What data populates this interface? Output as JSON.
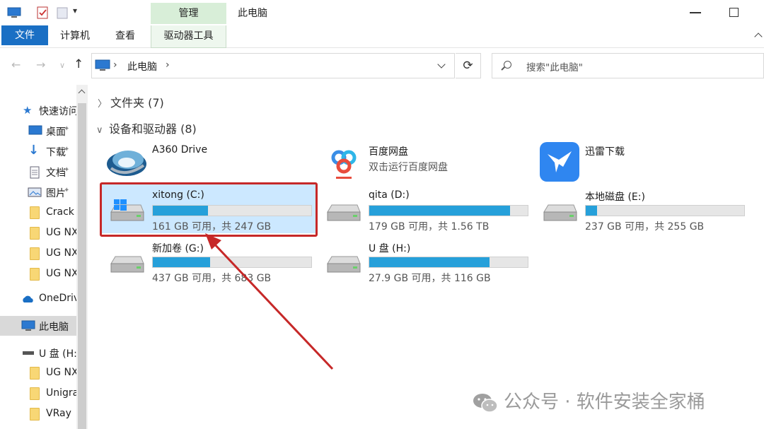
{
  "window": {
    "title": "此电脑",
    "manage_tab": "管理"
  },
  "ribbon": {
    "file": "文件",
    "computer": "计算机",
    "view": "查看",
    "drive_tools": "驱动器工具"
  },
  "address": {
    "crumb": "此电脑",
    "separator": "›"
  },
  "search": {
    "placeholder": "搜索\"此电脑\""
  },
  "nav": {
    "quick_access": "快速访问",
    "items": [
      {
        "label": "桌面",
        "icon": "desktop-icon",
        "pinned": true
      },
      {
        "label": "下载",
        "icon": "download-icon",
        "pinned": true
      },
      {
        "label": "文档",
        "icon": "document-icon",
        "pinned": true
      },
      {
        "label": "图片",
        "icon": "picture-icon",
        "pinned": true
      },
      {
        "label": "Crack",
        "icon": "folder-icon"
      },
      {
        "label": "UG NX",
        "icon": "folder-icon"
      },
      {
        "label": "UG NX",
        "icon": "folder-icon"
      },
      {
        "label": "UG NX",
        "icon": "folder-icon"
      }
    ],
    "onedrive": "OneDrive",
    "this_pc": "此电脑",
    "udisk": "U 盘 (H:)",
    "udisk_items": [
      {
        "label": "UG NX",
        "icon": "folder-icon"
      },
      {
        "label": "Unigraphics",
        "icon": "folder-icon"
      },
      {
        "label": "VRay",
        "icon": "folder-icon"
      }
    ]
  },
  "groups": {
    "folders": {
      "label": "文件夹 (7)",
      "expanded": false
    },
    "devices": {
      "label": "设备和驱动器 (8)",
      "expanded": true
    }
  },
  "apps": [
    {
      "name": "A360 Drive",
      "sub": "",
      "icon": "a360-icon"
    },
    {
      "name": "百度网盘",
      "sub": "双击运行百度网盘",
      "icon": "baidu-netdisk-icon"
    },
    {
      "name": "迅雷下载",
      "sub": "",
      "icon": "xunlei-icon"
    }
  ],
  "drives": [
    {
      "name": "xitong (C:)",
      "free": "161 GB 可用，共 247 GB",
      "used_fraction": 0.35,
      "system": true,
      "selected": true
    },
    {
      "name": "qita (D:)",
      "free": "179 GB 可用，共 1.56 TB",
      "used_fraction": 0.89
    },
    {
      "name": "本地磁盘 (E:)",
      "free": "237 GB 可用，共 255 GB",
      "used_fraction": 0.07
    },
    {
      "name": "新加卷 (G:)",
      "free": "437 GB 可用，共 683 GB",
      "used_fraction": 0.36
    },
    {
      "name": "U 盘 (H:)",
      "free": "27.9 GB 可用，共 116 GB",
      "used_fraction": 0.76
    }
  ],
  "watermark": "公众号 · 软件安装全家桶",
  "colors": {
    "accent": "#1a6fc4",
    "drive_bar": "#26a0da",
    "highlight": "#c62828",
    "selected": "#cce8ff"
  }
}
